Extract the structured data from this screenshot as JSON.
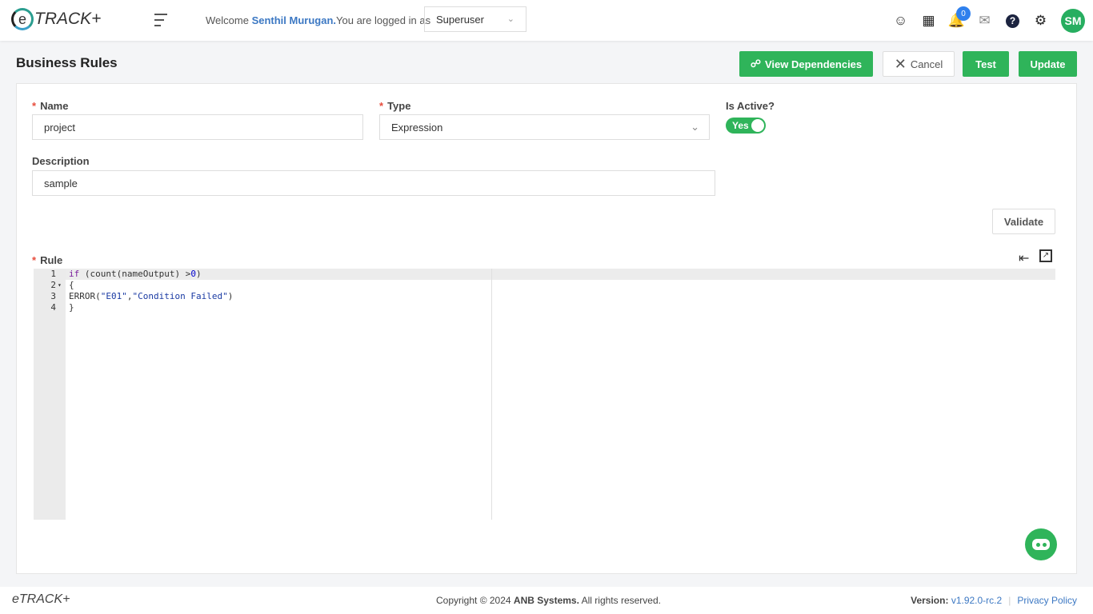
{
  "header": {
    "logo": "eTRACK+",
    "welcome_prefix": "Welcome ",
    "user_name": "Senthil Murugan.",
    "welcome_suffix": "You are logged in as",
    "role": "Superuser",
    "notification_count": "0",
    "avatar_initials": "SM"
  },
  "page": {
    "title": "Business Rules",
    "buttons": {
      "view_dependencies": "View Dependencies",
      "cancel": "Cancel",
      "test": "Test",
      "update": "Update",
      "validate": "Validate"
    }
  },
  "form": {
    "name_label": "Name",
    "name_value": "project",
    "type_label": "Type",
    "type_value": "Expression",
    "active_label": "Is Active?",
    "active_value": "Yes",
    "description_label": "Description",
    "description_value": "sample",
    "rule_label": "Rule"
  },
  "rule_code": [
    {
      "n": "1",
      "t": [
        [
          "kw",
          "if"
        ],
        [
          "",
          "(count(nameOutput) >"
        ],
        [
          "num",
          "0"
        ],
        [
          "",
          ")"
        ]
      ]
    },
    {
      "n": "2",
      "t": [
        [
          "",
          "{"
        ]
      ]
    },
    {
      "n": "3",
      "t": [
        [
          "",
          "ERROR("
        ],
        [
          "str",
          "\"E01\""
        ],
        [
          "",
          ","
        ],
        [
          "str",
          "\"Condition Failed\""
        ],
        [
          "",
          ")"
        ]
      ]
    },
    {
      "n": "4",
      "t": [
        [
          "",
          "}"
        ]
      ]
    }
  ],
  "footer": {
    "logo": "eTRACK+",
    "copyright_prefix": "Copyright © 2024 ",
    "company": "ANB Systems.",
    "copyright_suffix": " All rights reserved.",
    "version_label": "Version:",
    "version": "v1.92.0-rc.2",
    "privacy": "Privacy Policy"
  },
  "colors": {
    "primary": "#2fb45a",
    "link": "#3c78c3",
    "badge": "#2f80ed"
  }
}
